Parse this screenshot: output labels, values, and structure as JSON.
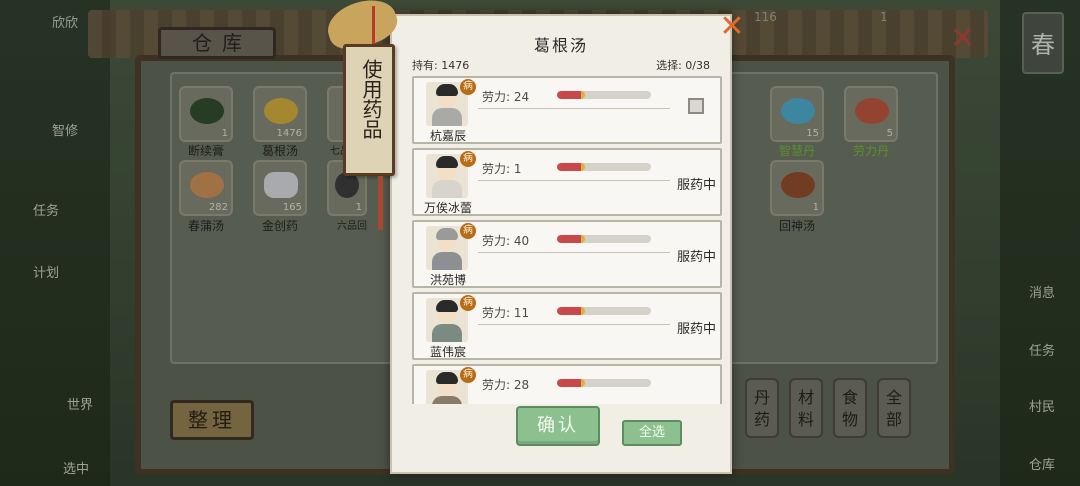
{
  "background": {
    "warehouse_title": "仓库",
    "arrange_label": "整理",
    "season_label": "春",
    "top_counter_1": "116",
    "top_counter_2": "1",
    "side_left": [
      {
        "label": "欣欣"
      },
      {
        "label": "智修"
      },
      {
        "label": "任务"
      },
      {
        "label": "计划"
      },
      {
        "label": "世界"
      },
      {
        "label": "选中"
      }
    ],
    "side_right": [
      {
        "label": "消息"
      },
      {
        "label": "任务"
      },
      {
        "label": "村民"
      },
      {
        "label": "仓库"
      }
    ],
    "items": [
      {
        "name": "断续膏",
        "count": "1",
        "color": "#2f4a2e"
      },
      {
        "name": "葛根汤",
        "count": "1476",
        "color": "#c9a53a"
      },
      {
        "name": "七品",
        "count": "",
        "color": "#555"
      },
      {
        "name": "春蒲汤",
        "count": "282",
        "color": "#c28a55"
      },
      {
        "name": "金创药",
        "count": "165",
        "color": "#cfd0d4"
      },
      {
        "name": "六品回",
        "count": "1",
        "color": "#3b3b3b"
      },
      {
        "name": "智慧丹",
        "count": "15",
        "color": "#4aa4c4"
      },
      {
        "name": "劳力丹",
        "count": "5",
        "color": "#b5523c"
      },
      {
        "name": "回神汤",
        "count": "1",
        "color": "#8a4a2a"
      }
    ],
    "categories": [
      {
        "label": "丹药"
      },
      {
        "label": "材料"
      },
      {
        "label": "食物"
      },
      {
        "label": "全部"
      }
    ]
  },
  "dialog": {
    "title": "葛根汤",
    "owned": "持有: 1476",
    "selected": "选择: 0/38",
    "tag_label": "使用药品",
    "confirm_label": "确认",
    "select_all_label": "全选",
    "sick_badge": "病",
    "rows": [
      {
        "name": "杭嘉辰",
        "labor_text": "劳力: 24",
        "labor_fraction": 0.3,
        "status": "",
        "selectable": true
      },
      {
        "name": "万俟冰蕾",
        "labor_text": "劳力: 1",
        "labor_fraction": 0.3,
        "status": "服药中",
        "selectable": false
      },
      {
        "name": "洪苑博",
        "labor_text": "劳力: 40",
        "labor_fraction": 0.3,
        "status": "服药中",
        "selectable": false
      },
      {
        "name": "蓝伟宸",
        "labor_text": "劳力: 11",
        "labor_fraction": 0.3,
        "status": "服药中",
        "selectable": false
      },
      {
        "name": "",
        "labor_text": "劳力: 28",
        "labor_fraction": 0.3,
        "status": "",
        "selectable": false
      }
    ]
  }
}
